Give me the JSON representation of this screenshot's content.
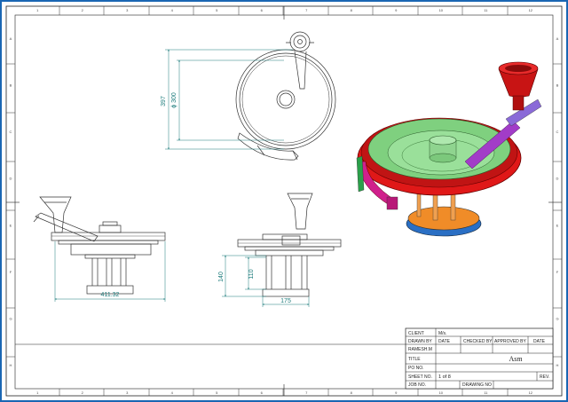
{
  "dimensions": {
    "overall_height": "397",
    "diameter": "ϕ 300",
    "base_width": "411.32",
    "height_140": "140",
    "height_110": "110",
    "width_175": "175"
  },
  "title_block": {
    "client_label": "CLIENT",
    "client_value": "M/s.",
    "drawn_by_label": "DRAWN BY",
    "date_label_1": "DATE",
    "checked_by_label": "CHECKED BY",
    "approved_by_label": "APPROVED BY",
    "date_label_2": "DATE",
    "drawn_by_value": "RAMESH.M",
    "title_label": "TITLE",
    "title_value": "Asm",
    "po_no_label": "PO NO.",
    "sheet_no_label": "SHEET NO.",
    "sheet_no_value": "1 of 8",
    "rev_label": "REV.",
    "job_no_label": "JOB NO.",
    "drawing_no_label": "DRAWING NO"
  },
  "zone_labels": {
    "top": [
      "1",
      "2",
      "3",
      "4",
      "5",
      "6",
      "7",
      "8",
      "9",
      "10",
      "11",
      "12"
    ],
    "side": [
      "A",
      "B",
      "C",
      "D",
      "E",
      "F",
      "G",
      "H"
    ]
  },
  "colors": {
    "frame_blue": "#1a66b3",
    "dimension_teal": "#1a7a7a",
    "rim_red": "#e01818",
    "tray_green": "#7fd07f",
    "funnel_red": "#c81414",
    "tube_purple": "#a23cc8",
    "base_orange": "#f08c28",
    "base_blue": "#2a6fc4",
    "clamp_magenta": "#d0208c"
  }
}
